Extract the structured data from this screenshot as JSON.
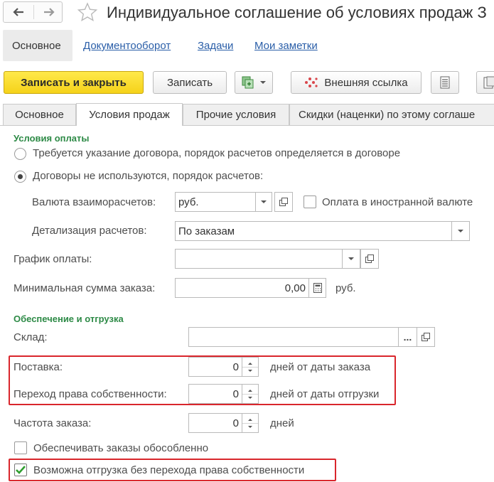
{
  "window": {
    "title": "Индивидуальное соглашение об условиях продаж З",
    "back_icon": "arrow-left-icon",
    "forward_icon": "arrow-right-icon",
    "favorite_icon": "star-icon"
  },
  "nav_links": {
    "main": "Основное",
    "docflow": "Документооборот",
    "tasks": "Задачи",
    "notes": "Мои заметки"
  },
  "toolbar": {
    "save_close": "Записать и закрыть",
    "save": "Записать",
    "external_link": "Внешняя ссылка"
  },
  "tabs": {
    "main": "Основное",
    "sales": "Условия продаж",
    "other": "Прочие условия",
    "discounts": "Скидки (наценки) по этому соглаше"
  },
  "payment": {
    "section": "Условия оплаты",
    "radio_contract": "Требуется указание договора, порядок расчетов определяется в договоре",
    "radio_no_contract": "Договоры не используются, порядок расчетов:",
    "currency_label": "Валюта взаиморасчетов:",
    "currency_value": "руб.",
    "foreign_label": "Оплата в иностранной валюте",
    "detail_label": "Детализация расчетов:",
    "detail_value": "По заказам",
    "schedule_label": "График оплаты:",
    "schedule_value": "",
    "min_sum_label": "Минимальная сумма заказа:",
    "min_sum_value": "0,00",
    "min_sum_unit": "руб."
  },
  "shipping": {
    "section": "Обеспечение и отгрузка",
    "warehouse_label": "Склад:",
    "warehouse_value": "",
    "delivery_label": "Поставка:",
    "delivery_value": "0",
    "delivery_unit": "дней от даты заказа",
    "ownership_label": "Переход права собственности:",
    "ownership_value": "0",
    "ownership_unit": "дней от даты отгрузки",
    "frequency_label": "Частота заказа:",
    "frequency_value": "0",
    "frequency_unit": "дней",
    "separate_label": "Обеспечивать заказы обособленно",
    "no_ownership_label": "Возможна отгрузка без перехода права собственности"
  },
  "colors": {
    "section_green": "#2d8a46",
    "primary_yellow": "#f5d21a",
    "link_blue": "#2a5ea8",
    "highlight_red": "#d9262c"
  }
}
